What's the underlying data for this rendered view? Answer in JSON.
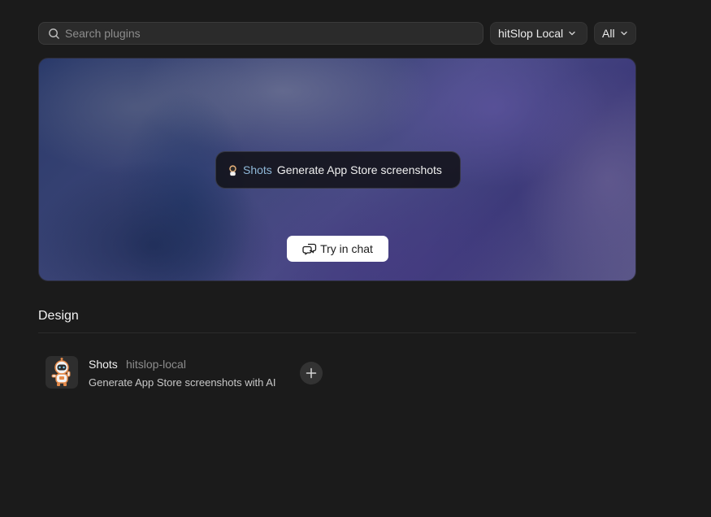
{
  "search": {
    "placeholder": "Search plugins",
    "value": ""
  },
  "filters": {
    "source": {
      "selected": "hitSlop Local"
    },
    "category": {
      "selected": "All"
    }
  },
  "hero": {
    "plugin_name": "Shots",
    "plugin_description": "Generate App Store screenshots",
    "cta_label": "Try in chat"
  },
  "section": {
    "title": "Design"
  },
  "plugins": [
    {
      "name": "Shots",
      "source": "hitslop-local",
      "description": "Generate App Store screenshots with AI"
    }
  ],
  "icons": {
    "search": "search-icon",
    "chevron": "chevron-down-icon",
    "chat": "chat-bubbles-icon",
    "plugin_avatar": "astronaut-avatar-icon",
    "add": "plus-icon"
  },
  "colors": {
    "background": "#1b1b1b",
    "accent_name": "#8fb8d8",
    "button_bg": "#ffffff"
  }
}
